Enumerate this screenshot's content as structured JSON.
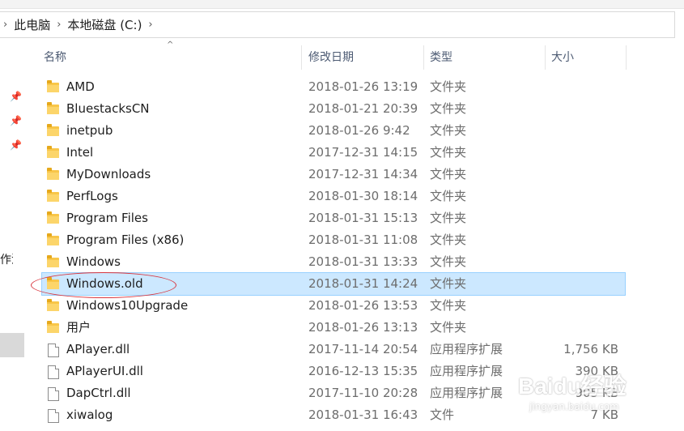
{
  "breadcrumb": {
    "items": [
      {
        "label": "此电脑"
      },
      {
        "label": "本地磁盘 (C:)"
      }
    ]
  },
  "left_pane": {
    "cut_label": "操作流"
  },
  "columns": {
    "name": "名称",
    "date": "修改日期",
    "type": "类型",
    "size": "大小"
  },
  "files": [
    {
      "name": "AMD",
      "date": "2018-01-26 13:19",
      "type": "文件夹",
      "size": "",
      "kind": "folder"
    },
    {
      "name": "BluestacksCN",
      "date": "2018-01-21 20:39",
      "type": "文件夹",
      "size": "",
      "kind": "folder"
    },
    {
      "name": "inetpub",
      "date": "2018-01-26 9:42",
      "type": "文件夹",
      "size": "",
      "kind": "folder"
    },
    {
      "name": "Intel",
      "date": "2017-12-31 14:15",
      "type": "文件夹",
      "size": "",
      "kind": "folder"
    },
    {
      "name": "MyDownloads",
      "date": "2017-12-31 14:34",
      "type": "文件夹",
      "size": "",
      "kind": "folder"
    },
    {
      "name": "PerfLogs",
      "date": "2018-01-30 18:14",
      "type": "文件夹",
      "size": "",
      "kind": "folder"
    },
    {
      "name": "Program Files",
      "date": "2018-01-31 15:13",
      "type": "文件夹",
      "size": "",
      "kind": "folder"
    },
    {
      "name": "Program Files (x86)",
      "date": "2018-01-31 11:08",
      "type": "文件夹",
      "size": "",
      "kind": "folder"
    },
    {
      "name": "Windows",
      "date": "2018-01-31 13:33",
      "type": "文件夹",
      "size": "",
      "kind": "folder"
    },
    {
      "name": "Windows.old",
      "date": "2018-01-31 14:24",
      "type": "文件夹",
      "size": "",
      "kind": "folder",
      "selected": true
    },
    {
      "name": "Windows10Upgrade",
      "date": "2018-01-26 13:53",
      "type": "文件夹",
      "size": "",
      "kind": "folder"
    },
    {
      "name": "用户",
      "date": "2018-01-26 13:13",
      "type": "文件夹",
      "size": "",
      "kind": "folder"
    },
    {
      "name": "APlayer.dll",
      "date": "2017-11-14 20:54",
      "type": "应用程序扩展",
      "size": "1,756 KB",
      "kind": "file"
    },
    {
      "name": "APlayerUI.dll",
      "date": "2016-12-13 15:35",
      "type": "应用程序扩展",
      "size": "390 KB",
      "kind": "file"
    },
    {
      "name": "DapCtrl.dll",
      "date": "2017-11-10 20:28",
      "type": "应用程序扩展",
      "size": "905 KB",
      "kind": "file"
    },
    {
      "name": "xiwalog",
      "date": "2018-01-31 16:43",
      "type": "文件",
      "size": "7 KB",
      "kind": "file"
    }
  ],
  "watermark": {
    "logo": "Baidu经验",
    "sub": "jingyan.baidu.com"
  },
  "colors": {
    "selection_bg": "#cce8ff",
    "selection_border": "#99d1ff",
    "folder": "#f8c649",
    "annotation_circle": "#d9363e"
  }
}
